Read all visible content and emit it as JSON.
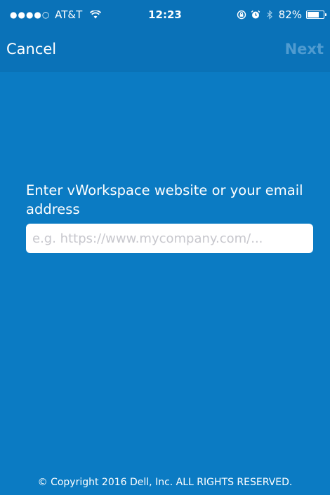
{
  "status_bar": {
    "signal": "●●●●○",
    "carrier": "AT&T",
    "time": "12:23",
    "battery_percent": "82%",
    "battery_level": 0.82,
    "icons": [
      "wifi-icon",
      "orientation-lock-icon",
      "alarm-icon",
      "bluetooth-icon",
      "battery-icon"
    ]
  },
  "nav": {
    "cancel_label": "Cancel",
    "next_label": "Next"
  },
  "form": {
    "prompt": "Enter vWorkspace website or your email address",
    "url_value": "",
    "url_placeholder": "e.g. https://www.mycompany.com/..."
  },
  "footer": {
    "copyright": "© Copyright 2016 Dell, Inc. ALL RIGHTS RESERVED."
  },
  "colors": {
    "background": "#0b7bc3",
    "bar": "#0a72b8",
    "next_disabled": "#4f9bd0",
    "text": "#ffffff"
  }
}
